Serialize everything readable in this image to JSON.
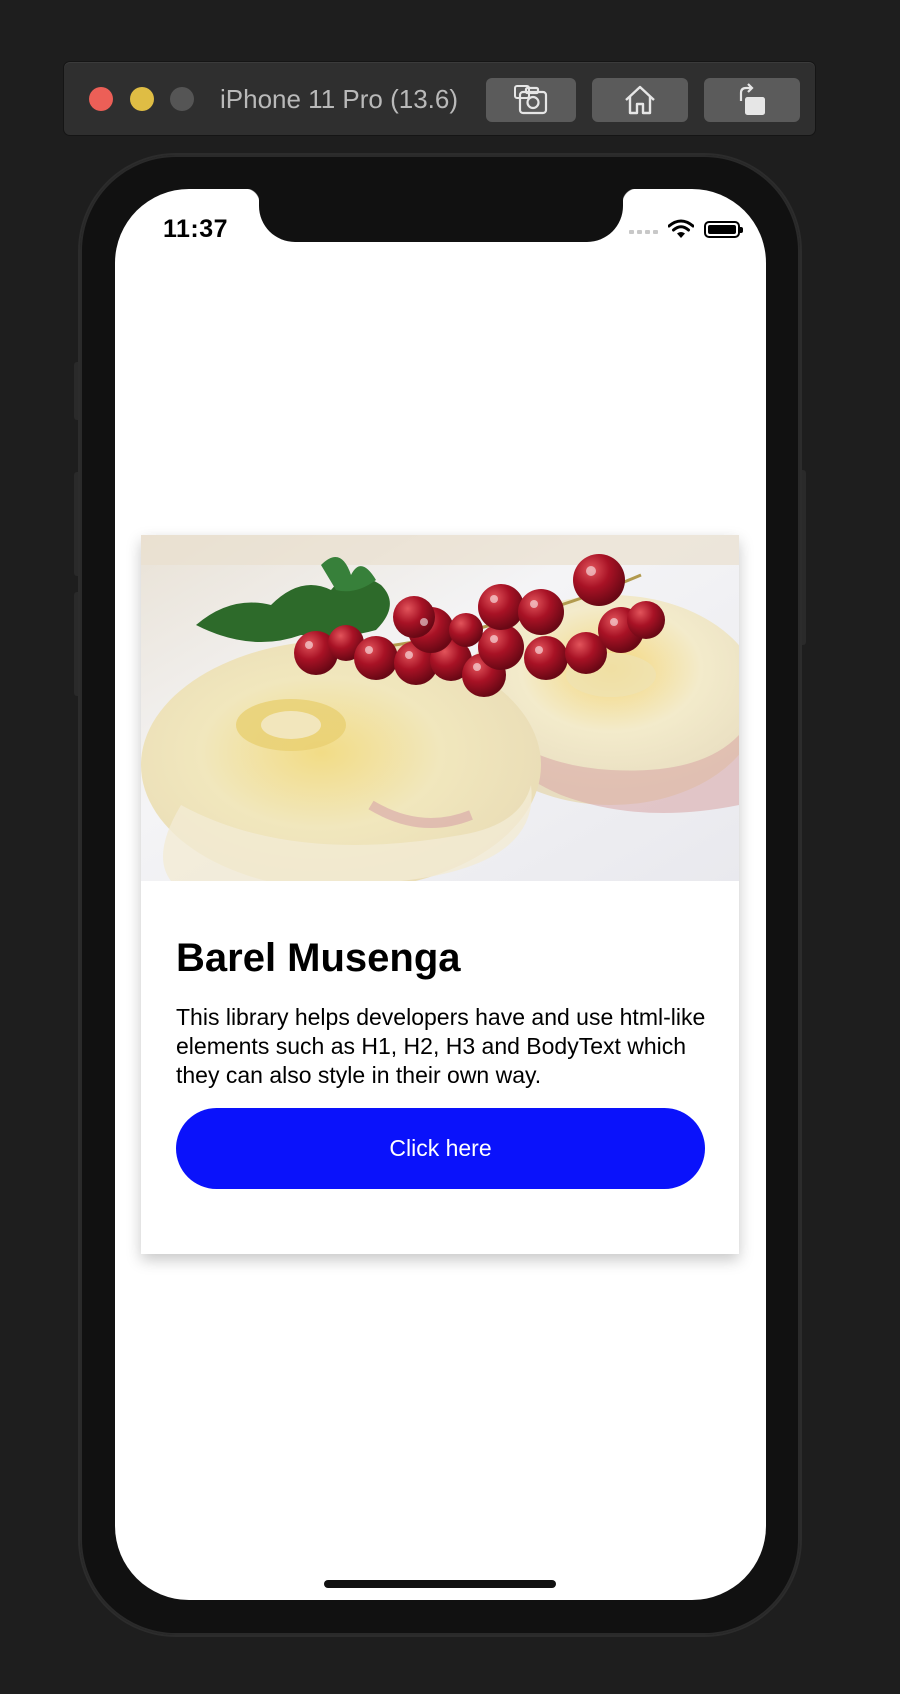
{
  "simulator": {
    "device_title": "iPhone 11 Pro (13.6)",
    "buttons": {
      "screenshot_icon": "camera-icon",
      "home_icon": "home-icon",
      "rotate_icon": "rotate-icon"
    }
  },
  "status_bar": {
    "time": "11:37",
    "icons": [
      "cellular-signal-icon",
      "wifi-icon",
      "battery-icon"
    ]
  },
  "card": {
    "image_icon": "food-photo",
    "title": "Barel Musenga",
    "body": "This library helps developers have and use html-like elements such as H1, H2, H3 and BodyText which they can also style in their own way.",
    "button_label": "Click here"
  },
  "colors": {
    "button": "#0a12fb",
    "background": "#ffffff",
    "window": "#1e1e1e"
  }
}
